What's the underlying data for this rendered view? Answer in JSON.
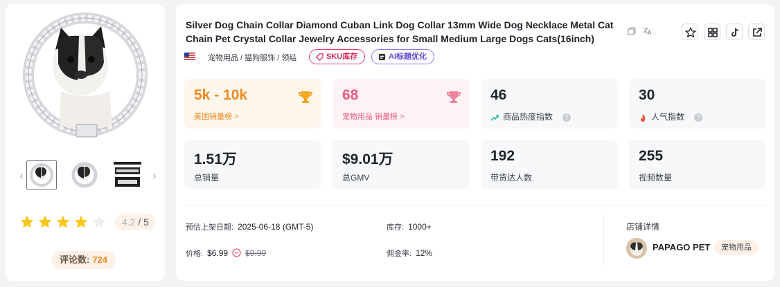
{
  "product": {
    "title": "Silver Dog Chain Collar Diamond Cuban Link Dog Collar 13mm Wide Dog Necklace Metal Cat Chain Pet Crystal Collar Jewelry Accessories for Small Medium Large Dogs Cats(16inch)",
    "category_path": "宠物用品 / 猫狗服饰 / 领结",
    "tags": {
      "sku": "SKU库存",
      "ai": "AI标题优化"
    }
  },
  "rating": {
    "value": "4.2",
    "max": "/ 5",
    "stars_filled": 4.2
  },
  "reviews": {
    "label": "评论数:",
    "count": "724"
  },
  "stats": {
    "us_sales": {
      "value": "5k - 10k",
      "label": "美国销量榜 >"
    },
    "cat_rank": {
      "value": "68",
      "label": "宠物用品 销量榜 >"
    },
    "heat": {
      "value": "46",
      "label": "商品热度指数"
    },
    "popularity": {
      "value": "30",
      "label": "人气指数"
    },
    "total_sales": {
      "value": "1.51万",
      "label": "总销量"
    },
    "gmv": {
      "value": "$9.01万",
      "label": "总GMV"
    },
    "creators": {
      "value": "192",
      "label": "带货达人数"
    },
    "videos": {
      "value": "255",
      "label": "视频数量"
    }
  },
  "info": {
    "launch_label": "预估上架日期:",
    "launch_value": "2025-06-18 (GMT-5)",
    "stock_label": "库存:",
    "stock_value": "1000+",
    "price_label": "价格:",
    "price_value": "$6.99",
    "original_price": "$9.99",
    "commission_label": "佣金率:",
    "commission_value": "12%"
  },
  "shop": {
    "section_title": "店铺详情",
    "name": "PAPAGO PET",
    "tag": "宠物用品"
  },
  "colors": {
    "orange": "#f08a23",
    "pink": "#e85c7e",
    "sku_tag": "#d42a5a",
    "ai_tag": "#5b4bd0",
    "star": "#f7c619"
  },
  "icons": [
    "copy-icon",
    "translate-icon",
    "star-favorite-icon",
    "grid-icon",
    "tiktok-icon",
    "external-link-icon",
    "trophy-icon",
    "trend-up-icon",
    "fire-icon",
    "help-icon",
    "coupon-icon",
    "us-flag-icon"
  ]
}
